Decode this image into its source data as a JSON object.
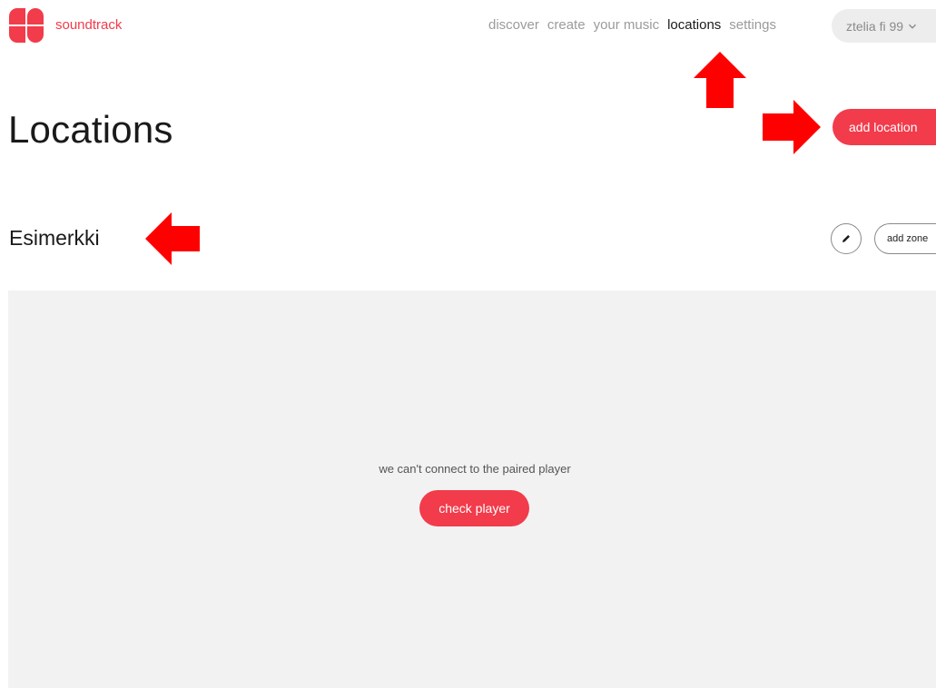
{
  "brand": {
    "name": "soundtrack",
    "logo_icon": "soundtrack-logo-icon",
    "accent_color": "#f23b4b"
  },
  "nav": {
    "items": [
      {
        "label": "discover",
        "active": false
      },
      {
        "label": "create",
        "active": false
      },
      {
        "label": "your music",
        "active": false
      },
      {
        "label": "locations",
        "active": true
      },
      {
        "label": "settings",
        "active": false
      }
    ]
  },
  "account": {
    "label": "ztelia fi 99",
    "icon": "chevron-down-icon"
  },
  "page": {
    "title": "Locations",
    "add_location_label": "add location"
  },
  "location": {
    "name": "Esimerkki",
    "edit_icon": "pencil-icon",
    "add_zone_label": "add zone"
  },
  "zone": {
    "message": "we can't connect to the paired player",
    "check_player_label": "check player",
    "panel_color": "#f2f2f2"
  },
  "annotations": {
    "arrow_color": "#ff0000",
    "arrows": [
      "arrow-up-icon",
      "arrow-right-icon",
      "arrow-left-icon"
    ]
  }
}
